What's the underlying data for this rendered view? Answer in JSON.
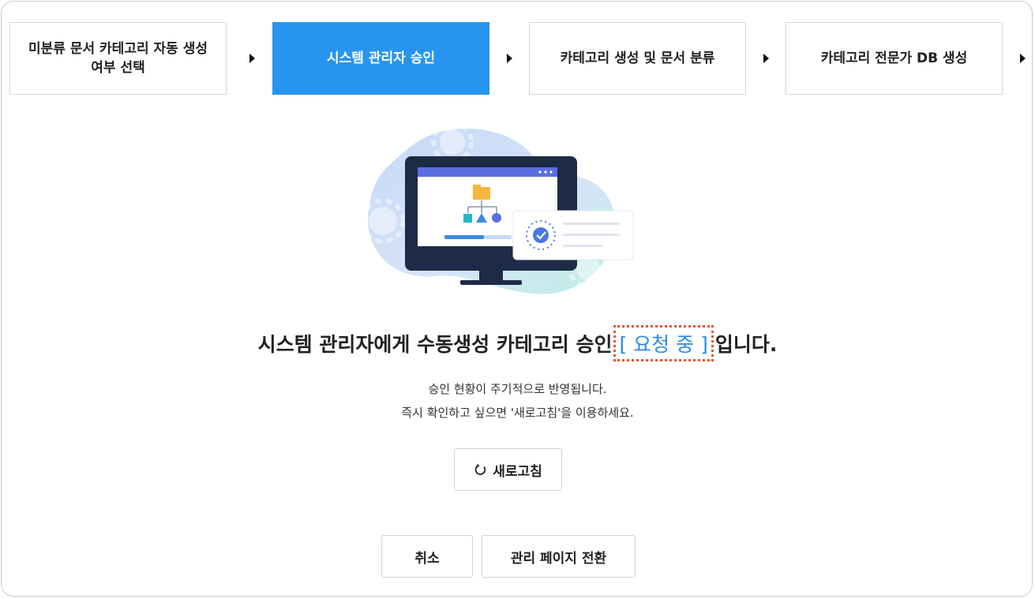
{
  "stepper": {
    "steps": [
      {
        "label_line1": "미분류 문서 카테고리 자동 생성",
        "label_line2": "여부 선택"
      },
      {
        "label": "시스템 관리자 승인"
      },
      {
        "label": "카테고리 생성 및 문서 분류"
      },
      {
        "label": "카테고리 전문가 DB 생성"
      }
    ],
    "active_step": 1,
    "active_color": "#2795f0"
  },
  "main": {
    "headline_before": "시스템 관리자에게 수동생성 카테고리 승인",
    "headline_status": "[ 요청 중 ]",
    "headline_after": "입니다.",
    "status_color": "#2a8be6",
    "highlight_color": "#e8552a",
    "sub_line1": "승인 현황이 주기적으로 반영됩니다.",
    "sub_line2": "즉시 확인하고 싶으면 '새로고침'을 이용하세요."
  },
  "buttons": {
    "refresh_label": "새로고침",
    "refresh_icon": "refresh-icon",
    "cancel_label": "취소",
    "admin_page_label": "관리 페이지 전환"
  }
}
